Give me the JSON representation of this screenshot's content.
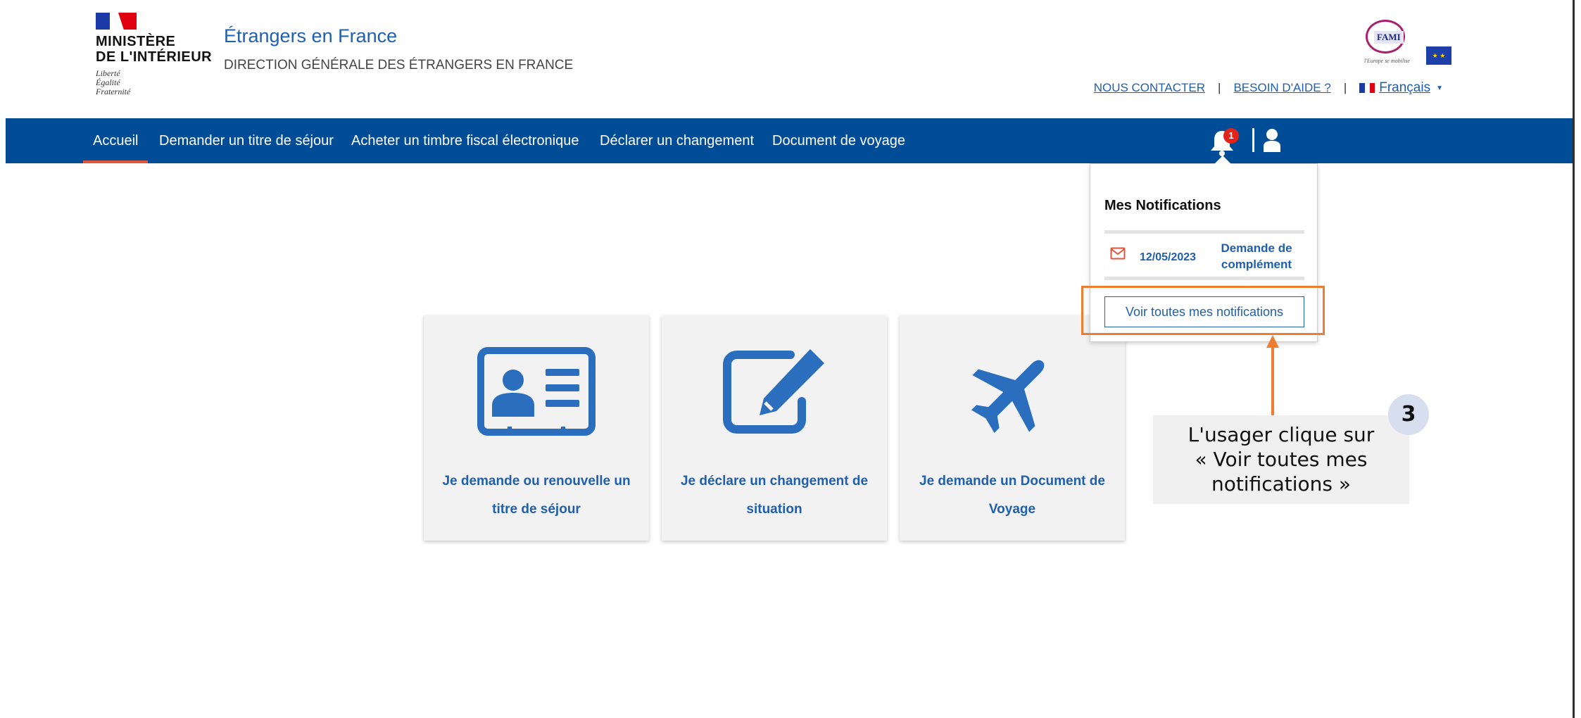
{
  "header": {
    "ministry": "MINISTÈRE\nDE L'INTÉRIEUR",
    "devise": "Liberté\nÉgalité\nFraternité",
    "site_title": "Étrangers en France",
    "site_subtitle": "DIRECTION GÉNÉRALE DES ÉTRANGERS EN FRANCE",
    "fami_logo": "FAMI",
    "fami_caption": "l'Europe se mobilise",
    "contact_link": "NOUS CONTACTER",
    "help_link": "BESOIN D'AIDE ?",
    "separator": "|",
    "language": "Français"
  },
  "nav": {
    "items": [
      {
        "label": "Accueil",
        "active": true
      },
      {
        "label": "Demander un titre de séjour"
      },
      {
        "label": "Acheter un timbre fiscal électronique"
      },
      {
        "label": "Déclarer un changement"
      },
      {
        "label": "Document de voyage"
      }
    ],
    "notification_count": "1"
  },
  "notifications": {
    "title": "Mes Notifications",
    "items": [
      {
        "date": "12/05/2023",
        "subject": "Demande de complément"
      }
    ],
    "view_all_label": "Voir toutes mes notifications"
  },
  "cards": [
    {
      "label": "Je demande ou renouvelle un titre de séjour",
      "icon": "id-card-icon"
    },
    {
      "label": "Je déclare un changement de situation",
      "icon": "edit-icon"
    },
    {
      "label": "Je demande un Document de Voyage",
      "icon": "plane-icon"
    }
  ],
  "annotation": {
    "callout": "L'usager clique sur\n« Voir toutes mes\nnotifications »",
    "step": "3"
  },
  "colors": {
    "brand_blue": "#004c96",
    "link_blue": "#1f5fad",
    "accent_orange": "#ed7d31",
    "active_underline": "#e2553b"
  }
}
